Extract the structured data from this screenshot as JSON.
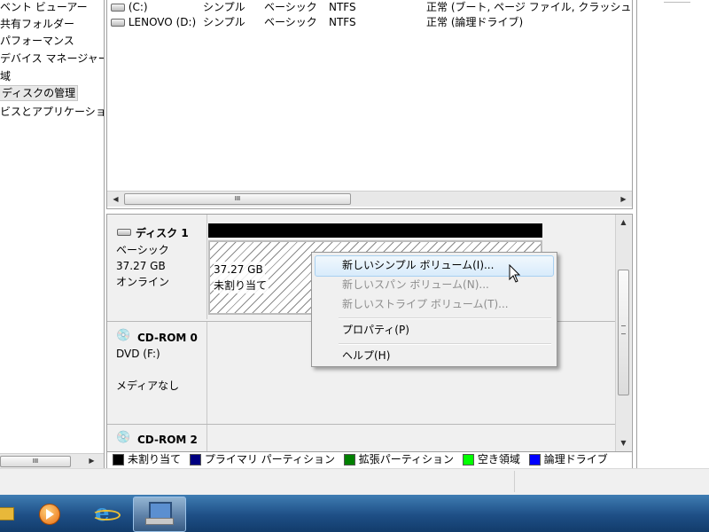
{
  "tree": {
    "items": [
      {
        "label": "ベント ビューアー"
      },
      {
        "label": "共有フォルダー"
      },
      {
        "label": "パフォーマンス"
      },
      {
        "label": "デバイス マネージャー"
      },
      {
        "label": "域"
      },
      {
        "label": "ディスクの管理"
      },
      {
        "label": "ビスとアプリケーショ"
      }
    ],
    "selected_index": 5
  },
  "volumes": {
    "rows": [
      {
        "name": "(C:)",
        "layout": "シンプル",
        "type": "ベーシック",
        "fs": "NTFS",
        "status": "正常 (ブート, ページ ファイル, クラッシュ"
      },
      {
        "name": "LENOVO (D:)",
        "layout": "シンプル",
        "type": "ベーシック",
        "fs": "NTFS",
        "status": "正常 (論理ドライブ)"
      }
    ],
    "hscroll_grip": "III"
  },
  "disks": [
    {
      "title": "ディスク 1",
      "type": "ベーシック",
      "size": "37.27 GB",
      "state": "オンライン",
      "partition": {
        "size": "37.27 GB",
        "state": "未割り当て"
      }
    },
    {
      "title": "CD-ROM 0",
      "line2": "DVD (F:)",
      "line3": "メディアなし"
    },
    {
      "title": "CD-ROM 2"
    }
  ],
  "context_menu": {
    "items": [
      {
        "label": "新しいシンプル ボリューム(I)...",
        "enabled": true,
        "highlighted": true
      },
      {
        "label": "新しいスパン ボリューム(N)...",
        "enabled": false
      },
      {
        "label": "新しいストライプ ボリューム(T)...",
        "enabled": false
      },
      {
        "label": "プロパティ(P)",
        "enabled": true
      },
      {
        "label": "ヘルプ(H)",
        "enabled": true
      }
    ]
  },
  "legend": [
    {
      "label": "未割り当て",
      "color": "#000000"
    },
    {
      "label": "プライマリ パーティション",
      "color": "#000080"
    },
    {
      "label": "拡張パーティション",
      "color": "#008000"
    },
    {
      "label": "空き領域",
      "color": "#00ff00"
    },
    {
      "label": "論理ドライブ",
      "color": "#0000ff"
    }
  ],
  "taskbar": {
    "icons": [
      "explorer-icon",
      "media-player-icon",
      "internet-explorer-icon",
      "computer-management-icon"
    ]
  },
  "colors": {
    "highlight_border": "#a8d0f1",
    "taskbar": "#1e4f86"
  }
}
